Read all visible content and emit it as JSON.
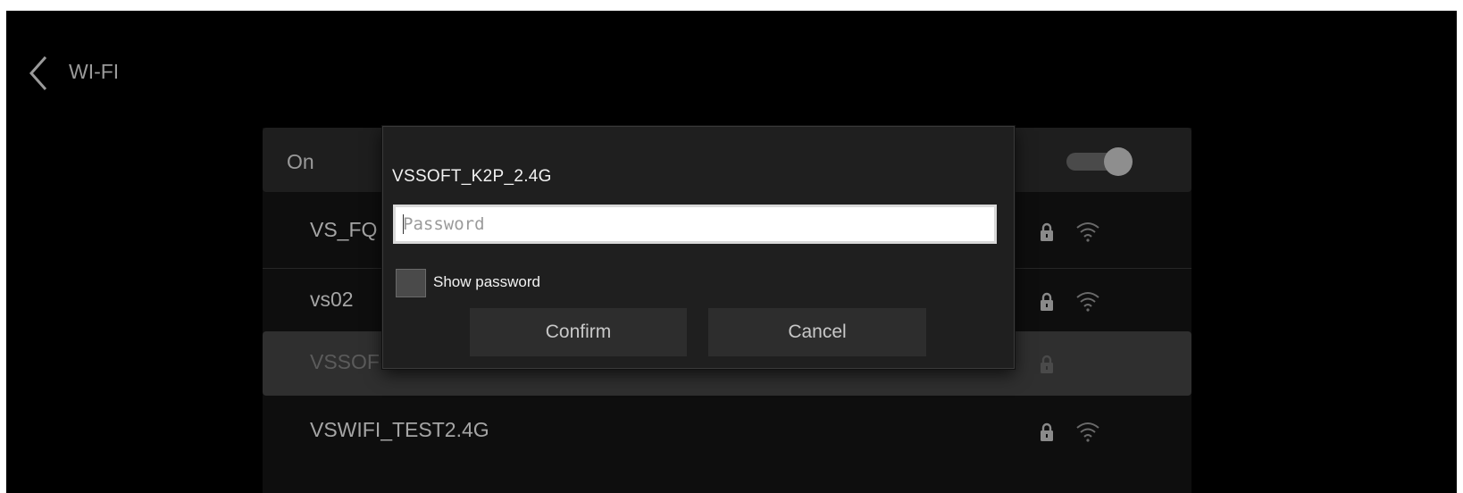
{
  "header": {
    "title": "WI-FI"
  },
  "wifi_toggle": {
    "label": "On",
    "state": "on"
  },
  "networks": [
    {
      "name": "VS_FQ",
      "secured": true,
      "selected": false
    },
    {
      "name": "vs02",
      "secured": true,
      "selected": false
    },
    {
      "name": "VSSOF",
      "secured": true,
      "selected": true
    },
    {
      "name": "VSWIFI_TEST2.4G",
      "secured": true,
      "selected": false
    }
  ],
  "dialog": {
    "title": "VSSOFT_K2P_2.4G",
    "password_value": "",
    "password_placeholder": "Password",
    "show_password_label": "Show password",
    "show_password_checked": false,
    "confirm_label": "Confirm",
    "cancel_label": "Cancel"
  },
  "colors": {
    "background": "#000000",
    "panel_row": "#1e1e1e",
    "selected_row": "#2f2f2f",
    "dialog_bg": "#1f1f1f",
    "button_bg": "#2d2d2d"
  }
}
